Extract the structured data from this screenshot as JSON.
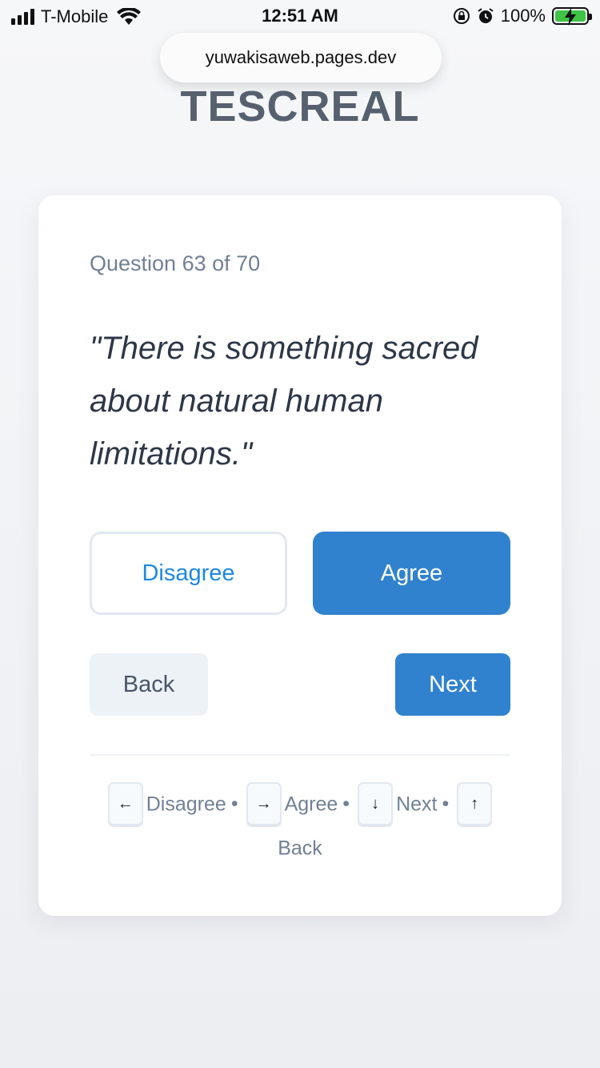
{
  "status_bar": {
    "carrier": "T-Mobile",
    "time": "12:51 AM",
    "battery": "100%"
  },
  "browser": {
    "url": "yuwakisaweb.pages.dev"
  },
  "app": {
    "title": "TESCREAL"
  },
  "question": {
    "counter": "Question 63 of 70",
    "text": "\"There is something sacred about natural human limitations.\""
  },
  "answers": {
    "disagree": "Disagree",
    "agree": "Agree"
  },
  "nav": {
    "back": "Back",
    "next": "Next"
  },
  "shortcuts": {
    "items": [
      {
        "key": "←",
        "label": "Disagree"
      },
      {
        "key": "→",
        "label": "Agree"
      },
      {
        "key": "↓",
        "label": "Next"
      },
      {
        "key": "↑",
        "label": "Back"
      }
    ],
    "separator": "•"
  },
  "colors": {
    "primary": "#3182ce",
    "disagree_text": "#1e88e5",
    "title": "#56606f",
    "muted": "#718096"
  }
}
